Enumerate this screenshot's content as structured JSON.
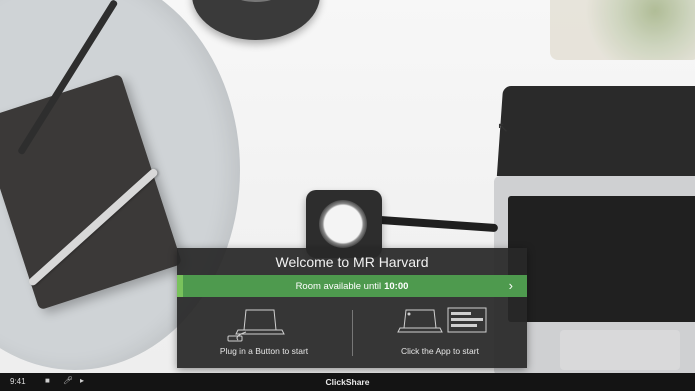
{
  "welcome": {
    "title": "Welcome to MR Harvard",
    "availability_text": "Room available until",
    "availability_time": "10:00",
    "option_button": "Plug in a Button to start",
    "option_app": "Click the App to start"
  },
  "taskbar": {
    "time": "9:41",
    "brand": "ClickShare",
    "icons": [
      "camera-icon",
      "microphone-icon",
      "speaker-icon"
    ]
  },
  "colors": {
    "panel": "#282828",
    "availability_bar": "#4e9a4e",
    "accent": "#79c25c",
    "taskbar": "#141414"
  }
}
